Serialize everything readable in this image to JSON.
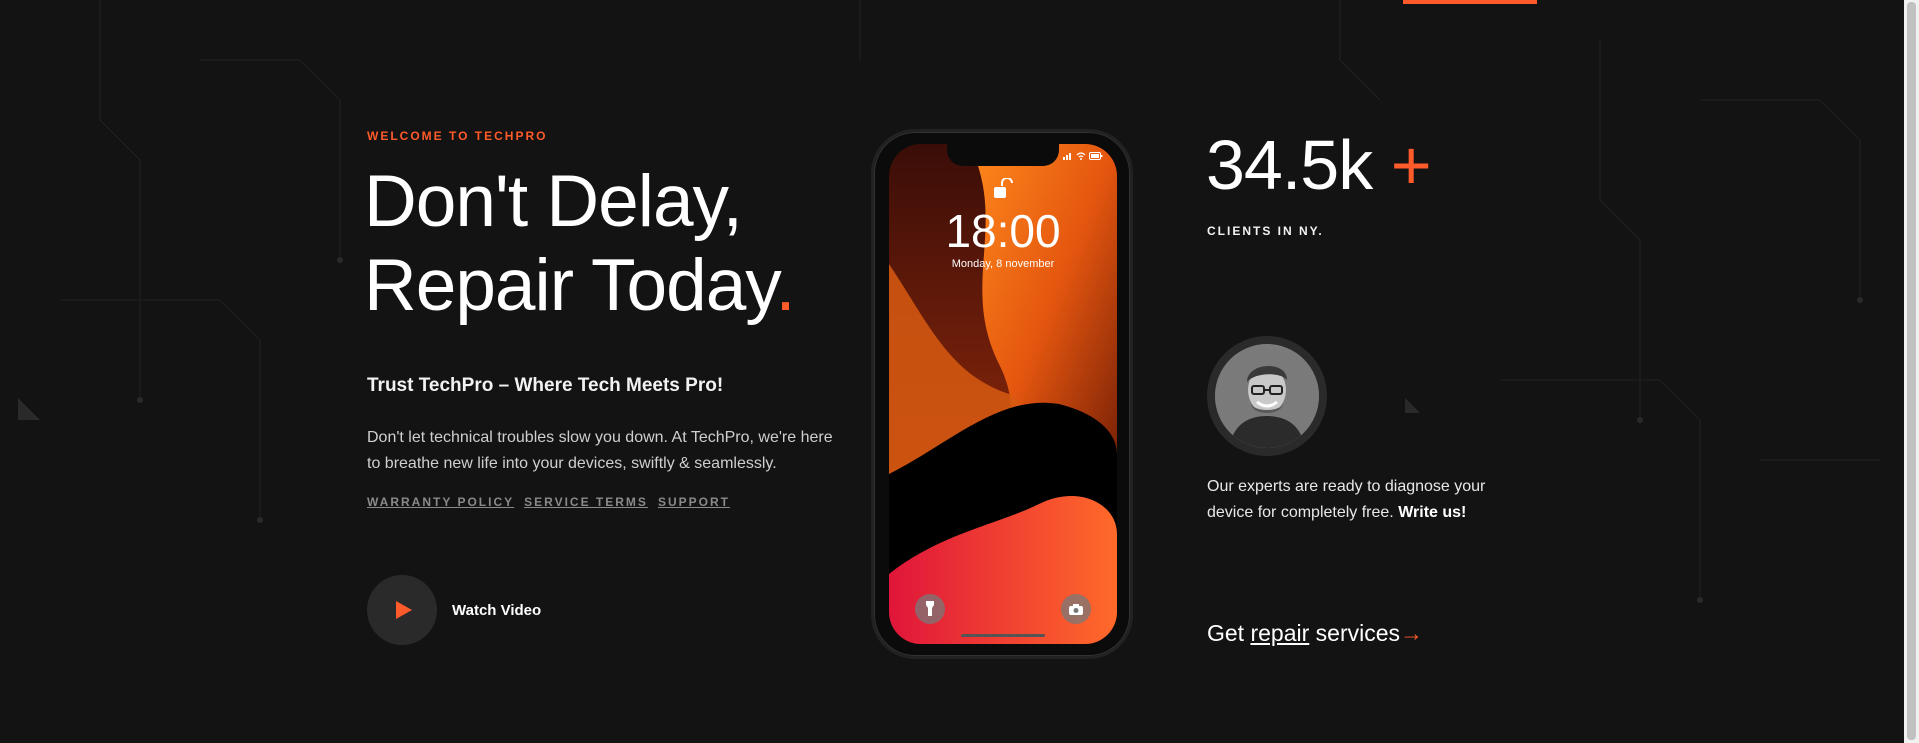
{
  "colors": {
    "accent": "#ff5a2a",
    "background": "#131313"
  },
  "hero": {
    "eyebrow": "WELCOME TO TECHPRO",
    "headline_line1": "Don't Delay,",
    "headline_line2": "Repair Today",
    "headline_dot": ".",
    "tagline": "Trust TechPro – Where Tech Meets Pro!",
    "description": "Don't let technical troubles slow you down. At TechPro, we're here to breathe new life into your devices, swiftly & seamlessly.",
    "links": [
      "WARRANTY POLICY",
      "SERVICE TERMS",
      "SUPPORT"
    ],
    "watch_label": "Watch Video"
  },
  "phone": {
    "time": "18:00",
    "date": "Monday, 8 november",
    "left_button_icon": "flashlight-icon",
    "right_button_icon": "camera-icon"
  },
  "stats": {
    "number": "34.5k",
    "plus": "+",
    "label": "CLIENTS IN NY."
  },
  "experts": {
    "text": "Our experts are ready to diagnose your device for completely free.",
    "cta": "Write us!"
  },
  "repair_cta": {
    "prefix": "Get",
    "link": "repair",
    "suffix": "services",
    "arrow": "→"
  }
}
